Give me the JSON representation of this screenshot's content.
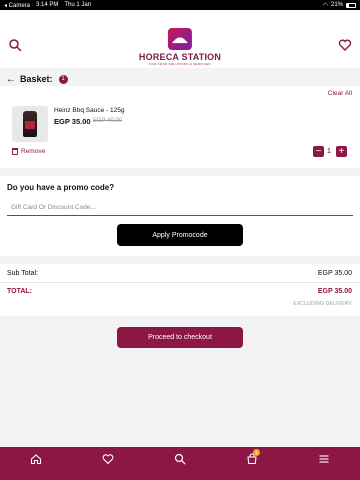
{
  "status_bar": {
    "carrier": "◂ Camera",
    "time": "3:14 PM",
    "date": "Thu 1 Jan",
    "battery": "21%"
  },
  "brand": {
    "name": "HORECA STATION",
    "tagline": "FOR FOOD SOLUTIONS & SERVICES",
    "color": "#8c1644"
  },
  "basket": {
    "title": "Basket:",
    "count": "1",
    "clear_all": "Clear All"
  },
  "item": {
    "name": "Heinz Bbq Sauce - 125g",
    "price": "EGP 35.00",
    "old_price": "EGP 40.00",
    "remove_label": "Remove",
    "quantity": "1",
    "minus": "−",
    "plus": "+"
  },
  "promo": {
    "title": "Do you have a promo code?",
    "placeholder": "Gift Card Or Discount Code...",
    "apply_label": "Apply Promocode"
  },
  "totals": {
    "subtotal_label": "Sub Total:",
    "subtotal_value": "EGP 35.00",
    "total_label": "TOTAL:",
    "total_value": "EGP 35.00",
    "note": "EXCLUDING DELIVERY"
  },
  "checkout": {
    "label": "Proceed to checkout"
  },
  "nav": {
    "cart_badge": "1",
    "items": [
      "home-icon",
      "heart-icon",
      "search-icon",
      "cart-icon",
      "menu-icon"
    ]
  }
}
